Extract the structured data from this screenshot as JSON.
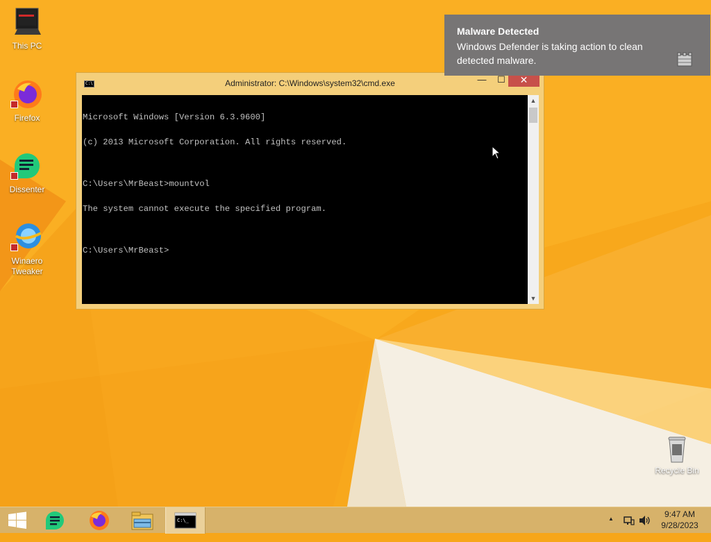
{
  "desktop": {
    "icons": [
      {
        "label": "This PC",
        "icon": "this-pc-icon"
      },
      {
        "label": "Firefox",
        "icon": "firefox-icon"
      },
      {
        "label": "Dissenter",
        "icon": "dissenter-icon"
      },
      {
        "label": "Winaero Tweaker",
        "icon": "winaero-tweaker-icon"
      },
      {
        "label": "Recycle Bin",
        "icon": "recycle-bin-icon"
      }
    ]
  },
  "cmd": {
    "title": "Administrator: C:\\Windows\\system32\\cmd.exe",
    "sysicon_text": "C:\\",
    "minimize_glyph": "—",
    "maximize_glyph": "☐",
    "close_glyph": "✕",
    "lines": [
      "Microsoft Windows [Version 6.3.9600]",
      "(c) 2013 Microsoft Corporation. All rights reserved.",
      "",
      "C:\\Users\\MrBeast>mountvol",
      "The system cannot execute the specified program.",
      "",
      "C:\\Users\\MrBeast>"
    ]
  },
  "toast": {
    "title": "Malware Detected",
    "body": "Windows Defender is taking action to clean detected malware.",
    "icon": "defender-castle-icon"
  },
  "taskbar": {
    "items": [
      {
        "name": "start",
        "icon": "windows-start-icon"
      },
      {
        "name": "dissenter",
        "icon": "dissenter-icon"
      },
      {
        "name": "firefox",
        "icon": "firefox-icon"
      },
      {
        "name": "file-explorer",
        "icon": "file-explorer-icon"
      },
      {
        "name": "command-prompt",
        "icon": "command-prompt-icon",
        "active": true
      }
    ],
    "tray": {
      "chevron": "▲",
      "time": "9:47 AM",
      "date": "9/28/2023"
    }
  },
  "colors": {
    "wallpaper": "#f7a61a",
    "window_frame": "#f4cf7b",
    "close_button": "#c7504a",
    "toast": "#777575",
    "taskbar": "#d7b26a"
  }
}
